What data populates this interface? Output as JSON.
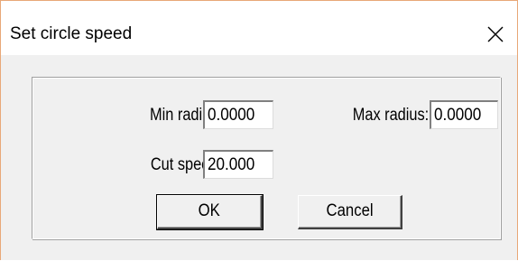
{
  "dialog": {
    "title": "Set circle speed",
    "close_icon": "close-icon"
  },
  "form": {
    "min_radius": {
      "label": "Min radius:",
      "value": "0.0000"
    },
    "max_radius": {
      "label": "Max radius:",
      "value": "0.0000"
    },
    "cut_speed": {
      "label": "Cut speed:",
      "value": "20.000"
    }
  },
  "buttons": {
    "ok": "OK",
    "cancel": "Cancel"
  },
  "colors": {
    "window_border": "#e8a878",
    "face": "#f0f0f0"
  }
}
